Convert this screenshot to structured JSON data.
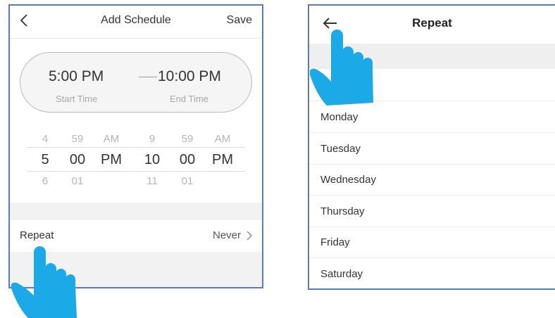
{
  "left_screen": {
    "header": {
      "back_icon": "chevron-left-icon",
      "title": "Add Schedule",
      "save_label": "Save"
    },
    "time_range": {
      "start_time": "5:00 PM",
      "start_label": "Start Time",
      "end_time": "10:00 PM",
      "end_label": "End Time"
    },
    "start_picker": {
      "above": {
        "hour": "4",
        "minute": "59",
        "ampm": "AM"
      },
      "selected": {
        "hour": "5",
        "minute": "00",
        "ampm": "PM"
      },
      "below": {
        "hour": "6",
        "minute": "01"
      }
    },
    "end_picker": {
      "above": {
        "hour": "9",
        "minute": "59",
        "ampm": "AM"
      },
      "selected": {
        "hour": "10",
        "minute": "00",
        "ampm": "PM"
      },
      "below": {
        "hour": "11",
        "minute": "01"
      }
    },
    "repeat_row": {
      "label": "Repeat",
      "value": "Never",
      "chevron_icon": "chevron-right-icon"
    }
  },
  "right_screen": {
    "header": {
      "back_icon": "arrow-left-icon",
      "title": "Repeat"
    },
    "days": [
      "Monday",
      "Tuesday",
      "Wednesday",
      "Thursday",
      "Friday",
      "Saturday"
    ]
  },
  "overlay": {
    "pointer_icon": "pointing-hand-icon",
    "accent_color": "#1ba9e8"
  },
  "colors": {
    "frame": "#5a7bc4",
    "band": "#f1f2f1"
  }
}
